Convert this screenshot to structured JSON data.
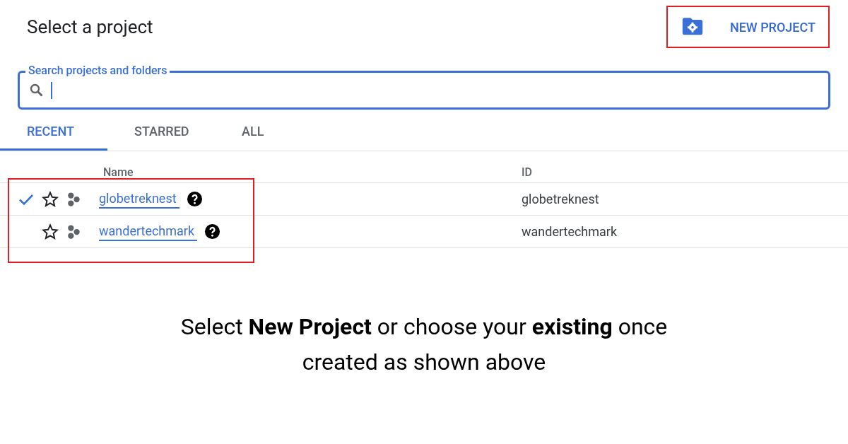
{
  "dialog": {
    "title": "Select a project",
    "new_project_button": "NEW PROJECT"
  },
  "search": {
    "label": "Search projects and folders"
  },
  "tabs": [
    {
      "label": "RECENT",
      "selected": true
    },
    {
      "label": "STARRED",
      "selected": false
    },
    {
      "label": "ALL",
      "selected": false
    }
  ],
  "table": {
    "columns": [
      "Name",
      "ID"
    ],
    "rows": [
      {
        "name": "globetreknest",
        "id": "globetreknest",
        "selected": true,
        "starred": false
      },
      {
        "name": "wandertechmark",
        "id": "wandertechmark",
        "selected": false,
        "starred": false
      }
    ]
  },
  "caption": "Select **New Project** or choose your **existing** once created as shown above"
}
